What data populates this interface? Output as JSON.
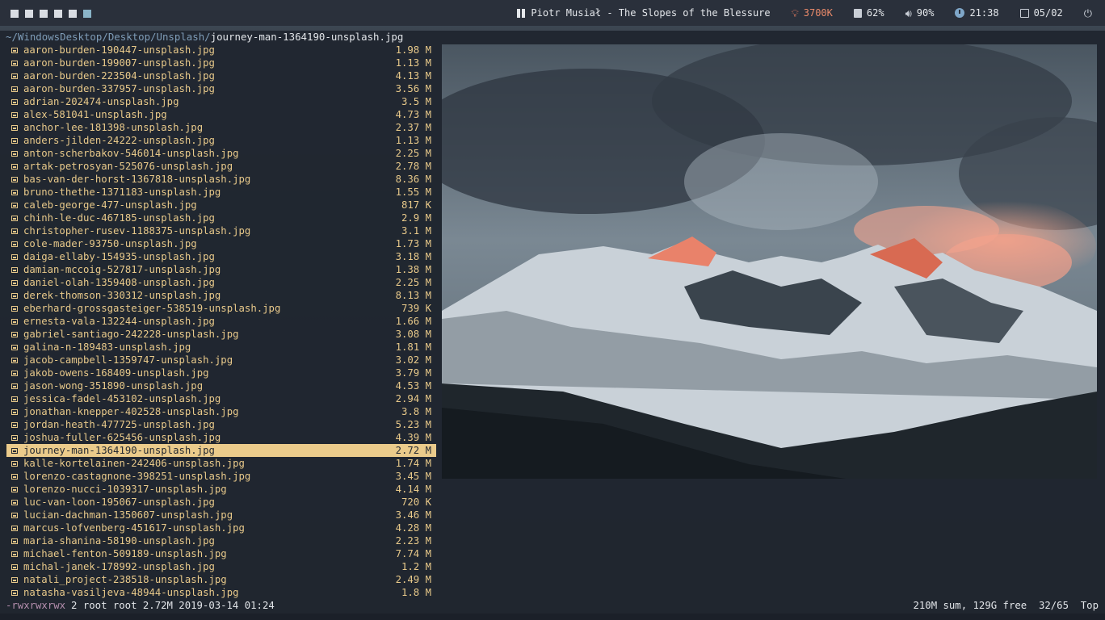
{
  "topbar": {
    "workspaces": [
      {
        "name": "workspace-1",
        "active": false
      },
      {
        "name": "workspace-2",
        "active": false
      },
      {
        "name": "workspace-3",
        "active": false
      },
      {
        "name": "workspace-4",
        "active": false
      },
      {
        "name": "workspace-5",
        "active": false
      },
      {
        "name": "workspace-6",
        "active": true
      }
    ],
    "now_playing": "Piotr Musiał - The Slopes of the Blessure",
    "color_temp": "3700K",
    "battery": "62%",
    "volume": "90%",
    "time": "21:38",
    "date": "05/02",
    "icons": [
      "pause-icon",
      "bulb-icon",
      "battery-icon",
      "volume-icon",
      "clock-icon",
      "calendar-icon",
      "power-icon"
    ]
  },
  "path": {
    "dir": "~/WindowsDesktop/Desktop/Unsplash/",
    "file": "journey-man-1364190-unsplash.jpg"
  },
  "files": [
    {
      "name": "aaron-burden-190447-unsplash.jpg",
      "size": "1.98 M"
    },
    {
      "name": "aaron-burden-199007-unsplash.jpg",
      "size": "1.13 M"
    },
    {
      "name": "aaron-burden-223504-unsplash.jpg",
      "size": "4.13 M"
    },
    {
      "name": "aaron-burden-337957-unsplash.jpg",
      "size": "3.56 M"
    },
    {
      "name": "adrian-202474-unsplash.jpg",
      "size": "3.5 M"
    },
    {
      "name": "alex-581041-unsplash.jpg",
      "size": "4.73 M"
    },
    {
      "name": "anchor-lee-181398-unsplash.jpg",
      "size": "2.37 M"
    },
    {
      "name": "anders-jilden-24222-unsplash.jpg",
      "size": "1.13 M"
    },
    {
      "name": "anton-scherbakov-546014-unsplash.jpg",
      "size": "2.25 M"
    },
    {
      "name": "artak-petrosyan-525076-unsplash.jpg",
      "size": "2.78 M"
    },
    {
      "name": "bas-van-der-horst-1367818-unsplash.jpg",
      "size": "8.36 M"
    },
    {
      "name": "bruno-thethe-1371183-unsplash.jpg",
      "size": "1.55 M"
    },
    {
      "name": "caleb-george-477-unsplash.jpg",
      "size": "817 K"
    },
    {
      "name": "chinh-le-duc-467185-unsplash.jpg",
      "size": "2.9 M"
    },
    {
      "name": "christopher-rusev-1188375-unsplash.jpg",
      "size": "3.1 M"
    },
    {
      "name": "cole-mader-93750-unsplash.jpg",
      "size": "1.73 M"
    },
    {
      "name": "daiga-ellaby-154935-unsplash.jpg",
      "size": "3.18 M"
    },
    {
      "name": "damian-mccoig-527817-unsplash.jpg",
      "size": "1.38 M"
    },
    {
      "name": "daniel-olah-1359408-unsplash.jpg",
      "size": "2.25 M"
    },
    {
      "name": "derek-thomson-330312-unsplash.jpg",
      "size": "8.13 M"
    },
    {
      "name": "eberhard-grossgasteiger-538519-unsplash.jpg",
      "size": "739 K"
    },
    {
      "name": "ernesta-vala-132244-unsplash.jpg",
      "size": "1.66 M"
    },
    {
      "name": "gabriel-santiago-242228-unsplash.jpg",
      "size": "3.08 M"
    },
    {
      "name": "galina-n-189483-unsplash.jpg",
      "size": "1.81 M"
    },
    {
      "name": "jacob-campbell-1359747-unsplash.jpg",
      "size": "3.02 M"
    },
    {
      "name": "jakob-owens-168409-unsplash.jpg",
      "size": "3.79 M"
    },
    {
      "name": "jason-wong-351890-unsplash.jpg",
      "size": "4.53 M"
    },
    {
      "name": "jessica-fadel-453102-unsplash.jpg",
      "size": "2.94 M"
    },
    {
      "name": "jonathan-knepper-402528-unsplash.jpg",
      "size": "3.8 M"
    },
    {
      "name": "jordan-heath-477725-unsplash.jpg",
      "size": "5.23 M"
    },
    {
      "name": "joshua-fuller-625456-unsplash.jpg",
      "size": "4.39 M"
    },
    {
      "name": "journey-man-1364190-unsplash.jpg",
      "size": "2.72 M",
      "selected": true
    },
    {
      "name": "kalle-kortelainen-242406-unsplash.jpg",
      "size": "1.74 M"
    },
    {
      "name": "lorenzo-castagnone-398251-unsplash.jpg",
      "size": "3.45 M"
    },
    {
      "name": "lorenzo-nucci-1039317-unsplash.jpg",
      "size": "4.14 M"
    },
    {
      "name": "luc-van-loon-195067-unsplash.jpg",
      "size": "720 K"
    },
    {
      "name": "lucian-dachman-1350607-unsplash.jpg",
      "size": "3.46 M"
    },
    {
      "name": "marcus-lofvenberg-451617-unsplash.jpg",
      "size": "4.28 M"
    },
    {
      "name": "maria-shanina-58190-unsplash.jpg",
      "size": "2.23 M"
    },
    {
      "name": "michael-fenton-509189-unsplash.jpg",
      "size": "7.74 M"
    },
    {
      "name": "michal-janek-178992-unsplash.jpg",
      "size": "1.2 M"
    },
    {
      "name": "natali_project-238518-unsplash.jpg",
      "size": "2.49 M"
    },
    {
      "name": "natasha-vasiljeva-48944-unsplash.jpg",
      "size": "1.8 M"
    }
  ],
  "status": {
    "permissions": "-rwxrwxrwx",
    "meta": "2 root root 2.72M 2019-03-14 01:24",
    "summary": "210M sum, 129G free  32/65  Top"
  },
  "colors": {
    "file_text": "#e8c98a",
    "selection": "#ebcb8b",
    "path_dir": "#7f9db8",
    "permissions": "#b48ead",
    "color_temp": "#e98a6a"
  }
}
